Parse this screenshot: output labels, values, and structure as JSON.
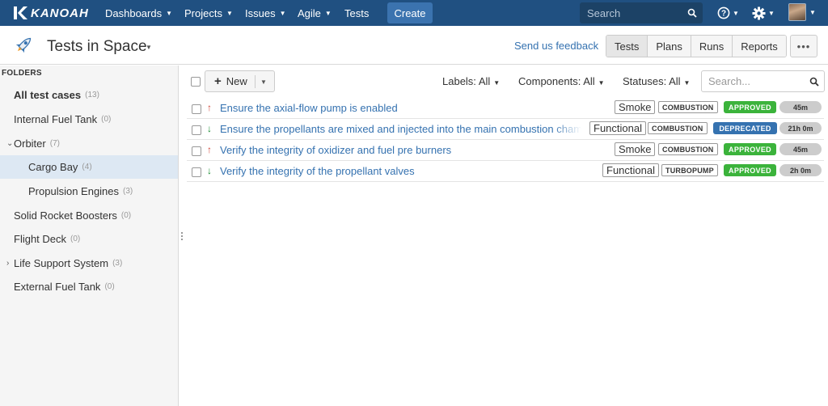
{
  "topnav": {
    "logo_text": "KANOAH",
    "items": [
      {
        "label": "Dashboards"
      },
      {
        "label": "Projects"
      },
      {
        "label": "Issues"
      },
      {
        "label": "Agile"
      },
      {
        "label": "Tests"
      }
    ],
    "create_label": "Create",
    "search_placeholder": "Search",
    "colors": {
      "bar": "#205081",
      "create": "#3b73af"
    }
  },
  "project": {
    "title": "Tests in Space",
    "feedback_label": "Send us feedback",
    "tabs": [
      {
        "label": "Tests"
      },
      {
        "label": "Plans"
      },
      {
        "label": "Runs"
      },
      {
        "label": "Reports"
      }
    ],
    "more_label": "•••"
  },
  "sidebar": {
    "heading": "FOLDERS",
    "folders": [
      {
        "label": "All test cases",
        "count": "(13)"
      },
      {
        "label": "Internal Fuel Tank",
        "count": "(0)"
      },
      {
        "label": "Orbiter",
        "count": "(7)"
      },
      {
        "label": "Cargo Bay",
        "count": "(4)"
      },
      {
        "label": "Propulsion Engines",
        "count": "(3)"
      },
      {
        "label": "Solid Rocket Boosters",
        "count": "(0)"
      },
      {
        "label": "Flight Deck",
        "count": "(0)"
      },
      {
        "label": "Life Support System",
        "count": "(3)"
      },
      {
        "label": "External Fuel Tank",
        "count": "(0)"
      }
    ]
  },
  "toolbar": {
    "new_label": "New",
    "filters": {
      "labels": "Labels: All",
      "components": "Components: All",
      "statuses": "Statuses: All"
    },
    "search_placeholder": "Search..."
  },
  "tests": [
    {
      "priority": "high",
      "priority_glyph": "↑",
      "title": "Ensure the axial-flow pump is enabled",
      "label": "Smoke",
      "component": "COMBUSTION",
      "status": "APPROVED",
      "estimate": "45m"
    },
    {
      "priority": "low",
      "priority_glyph": "↓",
      "title": "Ensure the propellants are mixed and injected into the main combustion chamber",
      "label": "Functional",
      "component": "COMBUSTION",
      "status": "DEPRECATED",
      "estimate": "21h 0m"
    },
    {
      "priority": "high",
      "priority_glyph": "↑",
      "title": "Verify the integrity of oxidizer and fuel pre burners",
      "label": "Smoke",
      "component": "COMBUSTION",
      "status": "APPROVED",
      "estimate": "45m"
    },
    {
      "priority": "low",
      "priority_glyph": "↓",
      "title": "Verify the integrity of the propellant valves",
      "label": "Functional",
      "component": "TURBOPUMP",
      "status": "APPROVED",
      "estimate": "2h 0m"
    }
  ],
  "colors": {
    "approved": "#3bb33b",
    "deprecated": "#3572b0",
    "link": "#3572b0",
    "priority_high": "#d04437",
    "priority_low": "#14892c",
    "selected_folder": "#dde8f3"
  }
}
